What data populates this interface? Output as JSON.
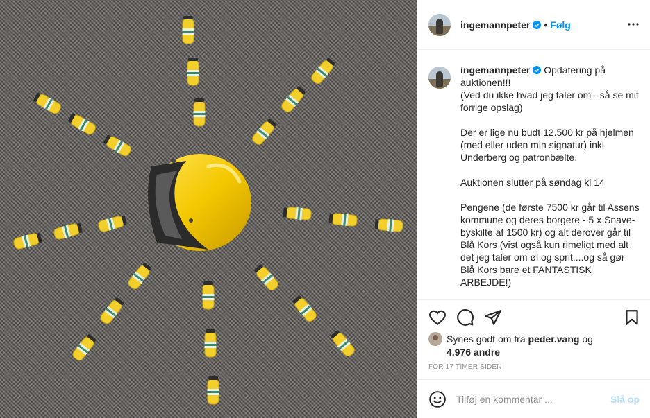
{
  "post": {
    "username": "ingemannpeter",
    "follow_label": "Følg",
    "dot": "•",
    "caption_lines": [
      "Opdatering på auktionen!!!",
      "(Ved du ikke hvad jeg taler om - så se mit forrige opslag)",
      "Der er lige nu budt 12.500 kr på hjelmen (med eller uden min signatur) inkl Underberg og patronbælte.",
      "Auktionen slutter på søndag kl 14",
      "Pengene (de første 7500 kr går til Assens kommune og deres borgere - 5 x Snave-byskilte af 1500 kr) og alt derover går til Blå Kors (vist også kun rimeligt med alt det jeg taler om øl og sprit....og så gør Blå Kors bare et FANTASTISK ARBEJDE!)"
    ],
    "likes_prefix": "Synes godt om fra",
    "likes_user": "peder.vang",
    "likes_and": "og",
    "likes_count": "4.976 andre",
    "timestamp": "FOR 17 TIMER SIDEN"
  },
  "comment": {
    "placeholder": "Tilføj en kommentar ...",
    "post_label": "Slå op"
  },
  "icons": {
    "verified": "verified-badge-icon",
    "more": "more-options-icon",
    "like": "heart-icon",
    "comment": "comment-icon",
    "share": "share-icon",
    "save": "bookmark-icon",
    "emoji": "emoji-icon"
  },
  "colors": {
    "accent": "#0095f6",
    "helmet": "#f2c200",
    "text": "#262626",
    "muted": "#8e8e8e"
  }
}
